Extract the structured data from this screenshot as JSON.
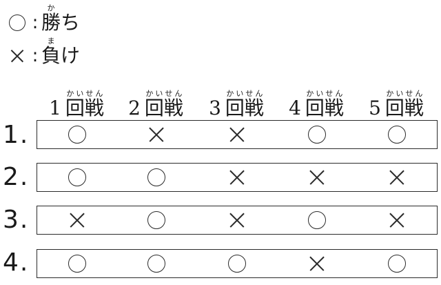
{
  "legend": {
    "win": {
      "symbol": "circle",
      "symbol_text": "○",
      "colon": ":",
      "kanji": "勝",
      "ruby": "か",
      "rest": "ち"
    },
    "lose": {
      "symbol": "cross",
      "symbol_text": "×",
      "colon": ":",
      "kanji": "負",
      "ruby": "ま",
      "rest": "け"
    }
  },
  "headers": [
    {
      "num": "1",
      "word": "回戦",
      "ruby": "かいせん"
    },
    {
      "num": "2",
      "word": "回戦",
      "ruby": "かいせん"
    },
    {
      "num": "3",
      "word": "回戦",
      "ruby": "かいせん"
    },
    {
      "num": "4",
      "word": "回戦",
      "ruby": "かいせん"
    },
    {
      "num": "5",
      "word": "回戦",
      "ruby": "かいせん"
    }
  ],
  "rows": [
    {
      "label": "1.",
      "results": [
        "○",
        "×",
        "×",
        "○",
        "○"
      ]
    },
    {
      "label": "2.",
      "results": [
        "○",
        "○",
        "×",
        "×",
        "×"
      ]
    },
    {
      "label": "3.",
      "results": [
        "×",
        "○",
        "×",
        "○",
        "×"
      ]
    },
    {
      "label": "4.",
      "results": [
        "○",
        "○",
        "○",
        "×",
        "○"
      ]
    }
  ]
}
